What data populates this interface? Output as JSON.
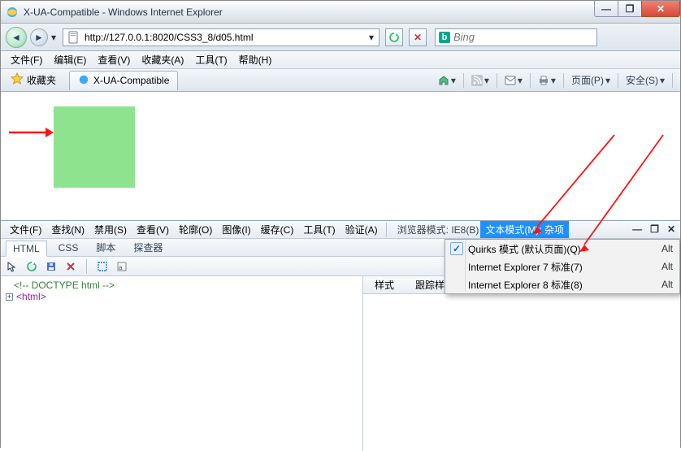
{
  "window": {
    "title": "X-UA-Compatible - Windows Internet Explorer",
    "min": "—",
    "max": "❐",
    "close": "✕"
  },
  "nav": {
    "back": "◄",
    "fwd": "►",
    "url": "http://127.0.0.1:8020/CSS3_8/d05.html",
    "drop": "▾",
    "refresh": "↻",
    "stop": "✕",
    "search_engine": "Bing",
    "search_placeholder": "Bing"
  },
  "menus": {
    "items": [
      "文件(F)",
      "编辑(E)",
      "查看(V)",
      "收藏夹(A)",
      "工具(T)",
      "帮助(H)"
    ]
  },
  "favbar": {
    "fav_label": "收藏夹",
    "tab_label": "X-UA-Compatible",
    "cmd_page": "页面(P)",
    "cmd_safety": "安全(S)"
  },
  "content": {
    "box_color": "#8ee38e"
  },
  "devtools": {
    "menus": [
      "文件(F)",
      "查找(N)",
      "禁用(S)",
      "查看(V)",
      "轮廓(O)",
      "图像(I)",
      "缓存(C)",
      "工具(T)",
      "验证(A)"
    ],
    "browser_mode_label": "浏览器模式: IE8(B)",
    "text_mode_label": "文本模式(M): ",
    "text_mode_value": "杂项",
    "tabs": [
      "HTML",
      "CSS",
      "脚本",
      "探查器"
    ],
    "right_tabs": [
      "样式",
      "跟踪样式"
    ],
    "tree": {
      "c1": "<!-- DOCTYPE html -->",
      "c2_open": "<",
      "c2_tag": "html",
      "c2_close": ">"
    },
    "dropdown": {
      "items": [
        {
          "label": "Quirks 模式 (默认页面)(Q)",
          "kb": "Alt",
          "checked": true
        },
        {
          "label": "Internet Explorer 7 标准(7)",
          "kb": "Alt",
          "checked": false
        },
        {
          "label": "Internet Explorer 8 标准(8)",
          "kb": "Alt",
          "checked": false
        }
      ]
    }
  }
}
